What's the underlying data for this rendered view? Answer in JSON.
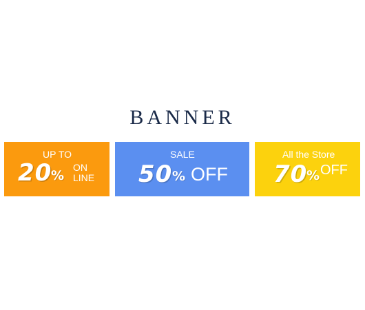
{
  "title": "BANNER",
  "banners": [
    {
      "top_text": "UP TO",
      "value": "20",
      "percent": "%",
      "side_line1": "ON",
      "side_line2": "LINE",
      "color": "#fb9a0e"
    },
    {
      "top_text": "SALE",
      "value": "50",
      "percent": "%",
      "side_text": "OFF",
      "color": "#5b8ff0"
    },
    {
      "top_text": "All the Store",
      "value": "70",
      "percent": "%",
      "side_text": "OFF",
      "color": "#fcd20d"
    }
  ]
}
